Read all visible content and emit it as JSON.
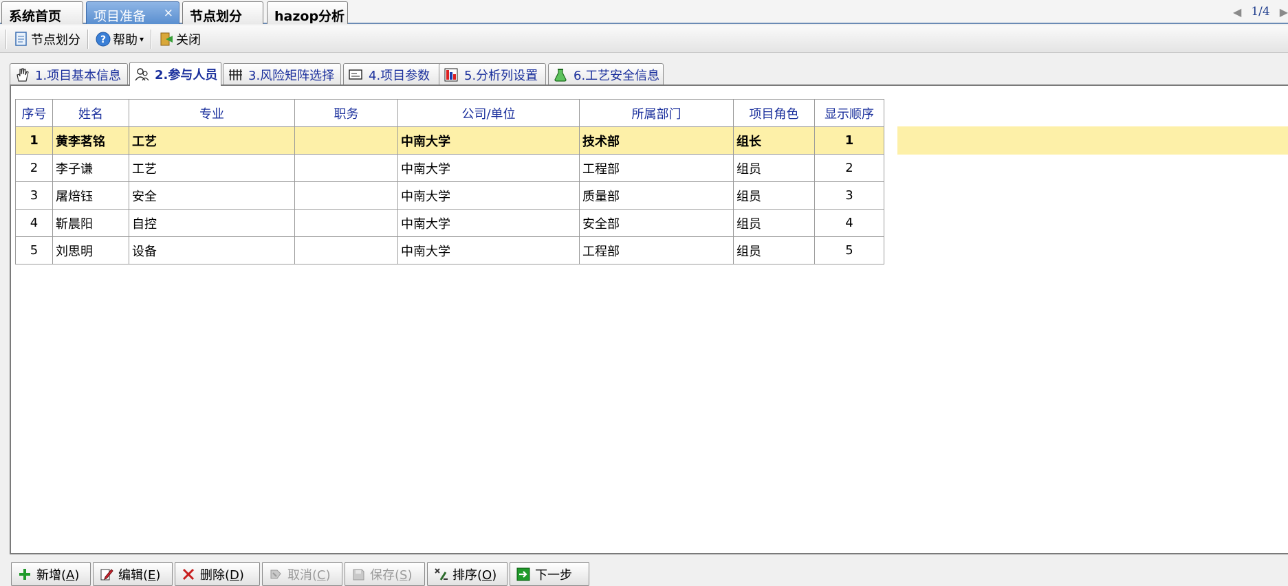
{
  "doc_tabs": [
    {
      "label": "系统首页",
      "active": false
    },
    {
      "label": "项目准备",
      "active": true,
      "close": "×"
    },
    {
      "label": "节点划分",
      "active": false
    },
    {
      "label": "hazop分析",
      "active": false
    }
  ],
  "pager": {
    "prev": "◀",
    "text": "1/4",
    "next": "▶"
  },
  "toolbar": {
    "node_split": "节点划分",
    "help": "帮助",
    "help_caret": "▾",
    "close": "关闭"
  },
  "form_tabs": [
    {
      "label": "1.项目基本信息",
      "icon": "hand-icon"
    },
    {
      "label": "2.参与人员",
      "icon": "people-icon",
      "active": true
    },
    {
      "label": "3.风险矩阵选择",
      "icon": "grid-icon"
    },
    {
      "label": "4.项目参数",
      "icon": "card-icon"
    },
    {
      "label": "5.分析列设置",
      "icon": "columns-icon"
    },
    {
      "label": "6.工艺安全信息",
      "icon": "flask-icon"
    }
  ],
  "table": {
    "headers": [
      "序号",
      "姓名",
      "专业",
      "职务",
      "公司/单位",
      "所属部门",
      "项目角色",
      "显示顺序"
    ],
    "rows": [
      [
        "1",
        "黄李茗铭",
        "工艺",
        "",
        "中南大学",
        "技术部",
        "组长",
        "1"
      ],
      [
        "2",
        "李子谦",
        "工艺",
        "",
        "中南大学",
        "工程部",
        "组员",
        "2"
      ],
      [
        "3",
        "屠焙钰",
        "安全",
        "",
        "中南大学",
        "质量部",
        "组员",
        "3"
      ],
      [
        "4",
        "靳晨阳",
        "自控",
        "",
        "中南大学",
        "安全部",
        "组员",
        "4"
      ],
      [
        "5",
        "刘思明",
        "设备",
        "",
        "中南大学",
        "工程部",
        "组员",
        "5"
      ]
    ]
  },
  "buttons": {
    "add": {
      "label": "新增(",
      "key": "A",
      "end": ")"
    },
    "edit": {
      "label": "编辑(",
      "key": "E",
      "end": ")"
    },
    "delete": {
      "label": "删除(",
      "key": "D",
      "end": ")"
    },
    "cancel": {
      "label": "取消(",
      "key": "C",
      "end": ")"
    },
    "save": {
      "label": "保存(",
      "key": "S",
      "end": ")"
    },
    "sort": {
      "label": "排序(",
      "key": "O",
      "end": ")"
    },
    "next": {
      "label": "下一步"
    }
  },
  "colors": {
    "accent": "#1a2f9c",
    "selected_row": "#fdf0a8",
    "active_tab": "#5a8fd0"
  }
}
